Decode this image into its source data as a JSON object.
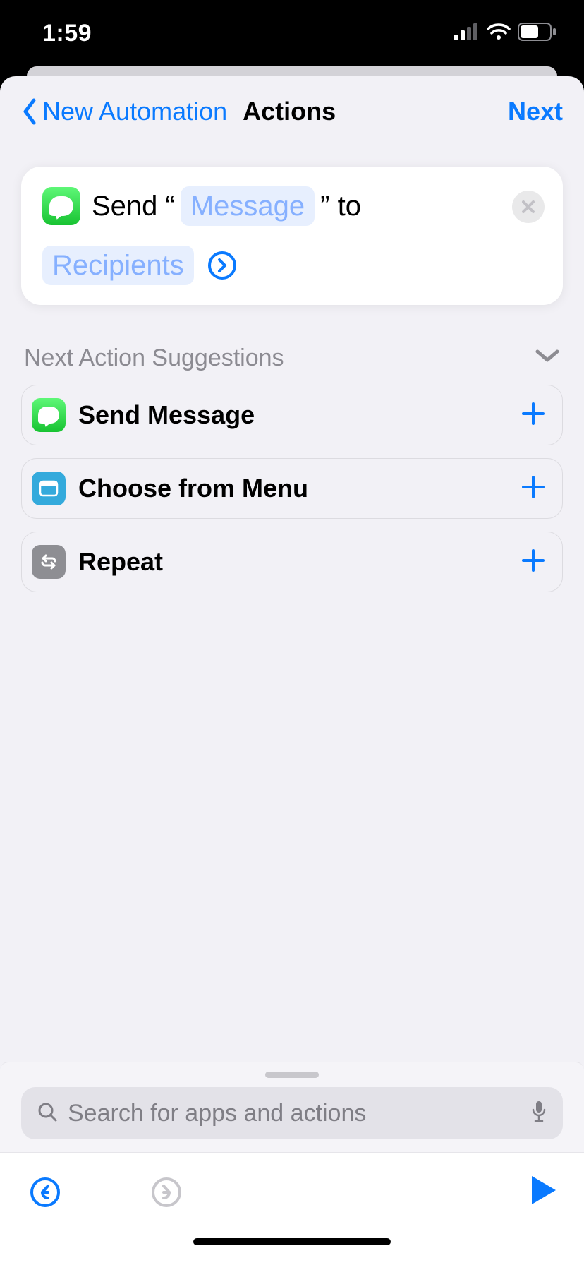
{
  "status": {
    "time": "1:59"
  },
  "nav": {
    "back_label": "New Automation",
    "title": "Actions",
    "next_label": "Next"
  },
  "action_card": {
    "prefix": "Send “",
    "message_token": "Message",
    "mid": "” to",
    "recipients_token": "Recipients"
  },
  "suggestions": {
    "header": "Next Action Suggestions",
    "items": [
      {
        "label": "Send Message",
        "icon": "messages"
      },
      {
        "label": "Choose from Menu",
        "icon": "menu"
      },
      {
        "label": "Repeat",
        "icon": "repeat"
      }
    ]
  },
  "search": {
    "placeholder": "Search for apps and actions"
  },
  "colors": {
    "accent": "#0a7aff"
  }
}
